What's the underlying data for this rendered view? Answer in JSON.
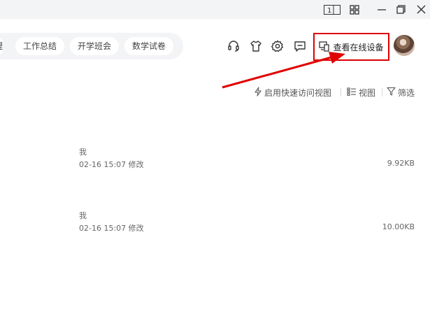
{
  "titlebar": {
    "icons": [
      "layout-toggle-icon",
      "grid-apps-icon",
      "minimize-icon",
      "restore-icon",
      "close-icon"
    ],
    "layout_toggle_label": "1"
  },
  "tags": [
    {
      "label": "理"
    },
    {
      "label": "工作总结"
    },
    {
      "label": "开学班会"
    },
    {
      "label": "数学试卷"
    }
  ],
  "header": {
    "icons": [
      "headset-icon",
      "tshirt-icon",
      "gear-icon",
      "message-icon"
    ],
    "device_button_label": "查看在线设备",
    "highlight_color": "#e00000"
  },
  "toolbar": {
    "quick_access_label": "启用快速访问视图",
    "view_label": "视图",
    "filter_label": "筛选"
  },
  "files": [
    {
      "owner": "我",
      "modified": "02-16 15:07 修改",
      "size": "9.92KB"
    },
    {
      "owner": "我",
      "modified": "02-16 15:07 修改",
      "size": "10.00KB"
    }
  ]
}
